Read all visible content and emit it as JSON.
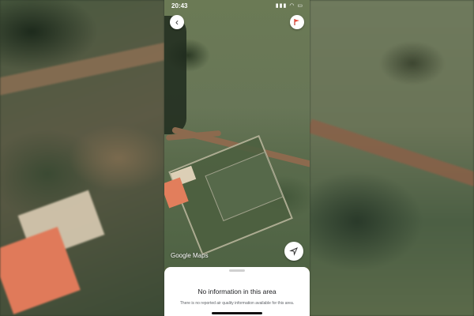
{
  "status_bar": {
    "time": "20:43",
    "icons": [
      "location-arrow",
      "signal",
      "wifi",
      "battery"
    ]
  },
  "map": {
    "brand": "Google Maps",
    "back_icon": "chevron-left-icon",
    "flag_icon": "flag-icon",
    "locate_icon": "navigation-arrow-icon"
  },
  "sheet": {
    "title": "No information in this area",
    "subtitle": "There is no reported air quality information available for this area."
  },
  "colors": {
    "road": "#8c6a4e",
    "roof": "#e27e5c",
    "sheet_bg": "#ffffff"
  }
}
